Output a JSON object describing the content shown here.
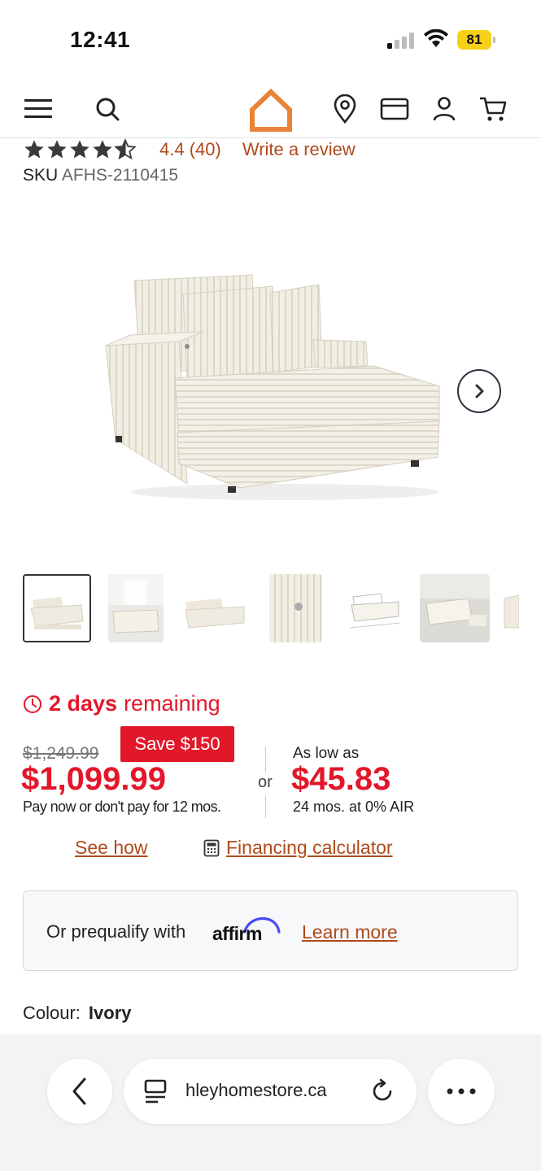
{
  "status_bar": {
    "time": "12:41",
    "battery": "81",
    "battery_color": "#f5d016"
  },
  "header": {
    "icons": [
      "menu-icon",
      "search-icon",
      "home-logo",
      "location-pin-icon",
      "credit-card-icon",
      "account-icon",
      "cart-icon"
    ],
    "logo_color": "#e8843a"
  },
  "product": {
    "rating_stars": 4.4,
    "rating_score": "4.4",
    "rating_count": "(40)",
    "write_review": "Write a review",
    "sku_label": "SKU",
    "sku_value": "AFHS-2110415",
    "thumbnail_count": 7
  },
  "promo": {
    "days_bold": "2 days",
    "days_rest": "remaining",
    "old_price": "$1,249.99",
    "save_badge": "Save $150",
    "price": "$1,099.99",
    "pay_note": "Pay now or don't pay for 12 mos.",
    "or": "or",
    "as_low_as": "As low as",
    "monthly": "$45.83",
    "terms": "24 mos. at 0% AIR",
    "see_how": "See how",
    "financing_calculator": "Financing calculator",
    "accent_color": "#e3172a",
    "link_color": "#b04a1c"
  },
  "affirm": {
    "text": "Or prequalify with",
    "logo": "affirm",
    "learn_more": "Learn more"
  },
  "colour": {
    "label": "Colour:",
    "value": "Ivory"
  },
  "browser": {
    "url": "hleyhomestore.ca"
  }
}
